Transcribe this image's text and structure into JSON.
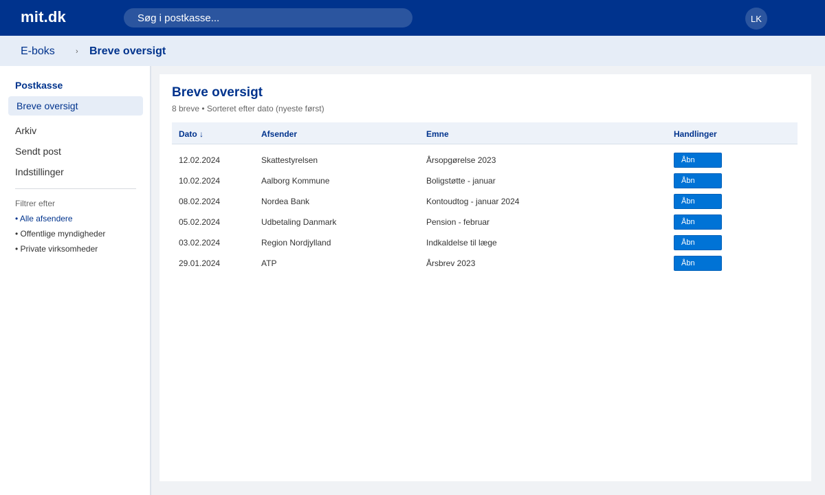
{
  "header": {
    "logo": "mit.dk",
    "search_placeholder": "Søg i postkasse...",
    "avatar_initials": "LK"
  },
  "breadcrumb": {
    "parent": "E-boks",
    "separator": "›",
    "current": "Breve oversigt"
  },
  "sidebar": {
    "heading": "Postkasse",
    "active_item": "Breve oversigt",
    "items": [
      "Arkiv",
      "Sendt post",
      "Indstillinger"
    ],
    "filter_title": "Filtrer efter",
    "filters": [
      "• Alle afsendere",
      "• Offentlige myndigheder",
      "• Private virksomheder"
    ]
  },
  "main": {
    "title": "Breve oversigt",
    "subtitle": "8 breve • Sorteret efter dato (nyeste først)",
    "columns": {
      "date": "Dato ↓",
      "sender": "Afsender",
      "subject": "Emne",
      "actions": "Handlinger"
    },
    "open_label": "Åbn",
    "rows": [
      {
        "date": "12.02.2024",
        "sender": "Skattestyrelsen",
        "subject": "Årsopgørelse 2023"
      },
      {
        "date": "10.02.2024",
        "sender": "Aalborg Kommune",
        "subject": "Boligstøtte - januar"
      },
      {
        "date": "08.02.2024",
        "sender": "Nordea Bank",
        "subject": "Kontoudtog - januar 2024"
      },
      {
        "date": "05.02.2024",
        "sender": "Udbetaling Danmark",
        "subject": "Pension - februar"
      },
      {
        "date": "03.02.2024",
        "sender": "Region Nordjylland",
        "subject": "Indkaldelse til læge"
      },
      {
        "date": "29.01.2024",
        "sender": "ATP",
        "subject": "Årsbrev 2023"
      }
    ]
  },
  "colors": {
    "brand": "#00338d",
    "button": "#0073d6",
    "active_bg": "#e6edf7"
  }
}
